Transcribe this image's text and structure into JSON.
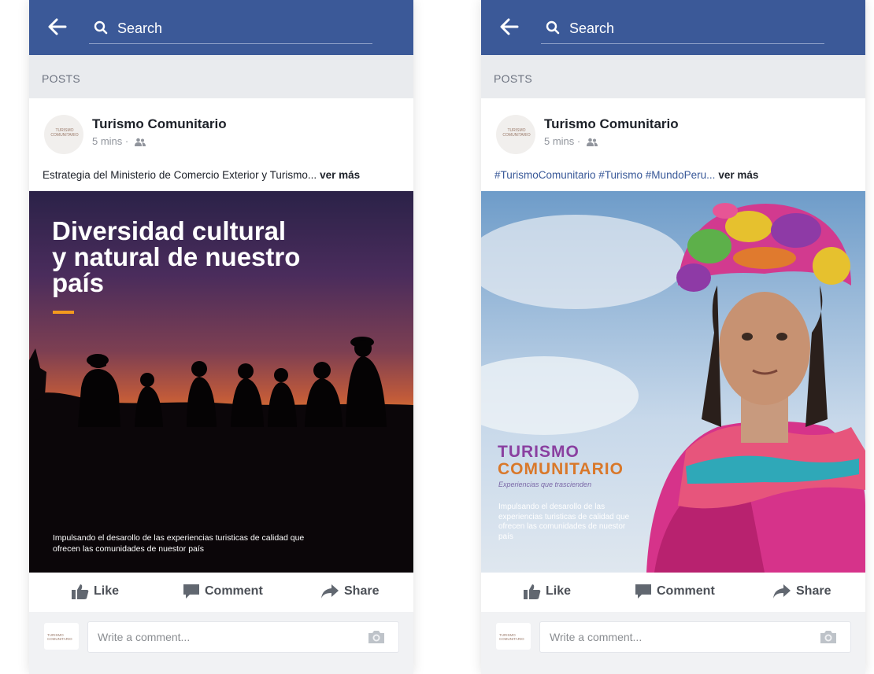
{
  "search": {
    "placeholder": "Search"
  },
  "section_label": "POSTS",
  "posts": [
    {
      "page_name": "Turismo Comunitario",
      "timestamp": "5 mins",
      "separator": "·",
      "avatar_text": "TURISMO COMUNITARIO",
      "text": "Estrategia del Ministerio de Comercio Exterior y Turismo...",
      "see_more": "ver más",
      "image": {
        "title": "Diversidad cultural y natural de nuestro país",
        "caption": "Impulsando el desarollo de las experiencias turisticas de calidad que ofrecen las comunidades de nuestor país"
      }
    },
    {
      "page_name": "Turismo Comunitario",
      "timestamp": "5 mins",
      "separator": "·",
      "avatar_text": "TURISMO COMUNITARIO",
      "text": "#TurismoComunitario #Turismo #MundoPeru...",
      "see_more": "ver más",
      "image": {
        "brand_line1": "TURISMO",
        "brand_line2": "COMUNITARIO",
        "tagline": "Experiencias que trascienden",
        "caption": "Impulsando el desarollo de las experiencias turisticas de calidad que ofrecen las comunidades de nuestor país"
      }
    }
  ],
  "actions": {
    "like": "Like",
    "comment": "Comment",
    "share": "Share"
  },
  "comment_box": {
    "placeholder": "Write a comment..."
  },
  "colors": {
    "header": "#3b5998",
    "posts_bar": "#e9ebee",
    "accent_orange": "#f39a1e",
    "hashtag": "#385898"
  }
}
